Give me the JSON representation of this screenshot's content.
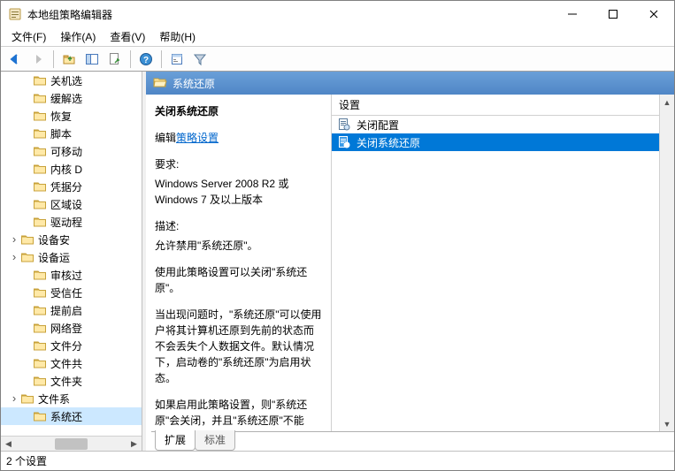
{
  "window": {
    "title": "本地组策略编辑器"
  },
  "menu": {
    "file": "文件(F)",
    "action": "操作(A)",
    "view": "查看(V)",
    "help": "帮助(H)"
  },
  "tree": {
    "items": [
      {
        "label": "关机选",
        "indent": 4,
        "exp": ""
      },
      {
        "label": "缓解选",
        "indent": 4,
        "exp": ""
      },
      {
        "label": "恢复",
        "indent": 4,
        "exp": ""
      },
      {
        "label": "脚本",
        "indent": 4,
        "exp": ""
      },
      {
        "label": "可移动",
        "indent": 4,
        "exp": ""
      },
      {
        "label": "内核 D",
        "indent": 4,
        "exp": ""
      },
      {
        "label": "凭据分",
        "indent": 4,
        "exp": ""
      },
      {
        "label": "区域设",
        "indent": 4,
        "exp": ""
      },
      {
        "label": "驱动程",
        "indent": 4,
        "exp": ""
      },
      {
        "label": "设备安",
        "indent": 3,
        "exp": ">"
      },
      {
        "label": "设备运",
        "indent": 3,
        "exp": ">"
      },
      {
        "label": "审核过",
        "indent": 4,
        "exp": ""
      },
      {
        "label": "受信任",
        "indent": 4,
        "exp": ""
      },
      {
        "label": "提前启",
        "indent": 4,
        "exp": ""
      },
      {
        "label": "网络登",
        "indent": 4,
        "exp": ""
      },
      {
        "label": "文件分",
        "indent": 4,
        "exp": ""
      },
      {
        "label": "文件共",
        "indent": 4,
        "exp": ""
      },
      {
        "label": "文件夹",
        "indent": 4,
        "exp": ""
      },
      {
        "label": "文件系",
        "indent": 3,
        "exp": ">"
      },
      {
        "label": "系统还",
        "indent": 4,
        "exp": "",
        "selected": true
      }
    ]
  },
  "right": {
    "header": "系统还原",
    "desc": {
      "title": "关闭系统还原",
      "edit_prefix": "编辑",
      "edit_link": "策略设置",
      "req_label": "要求:",
      "req_text": "Windows Server 2008 R2 或 Windows 7 及以上版本",
      "desc_label": "描述:",
      "desc_text1": "允许禁用\"系统还原\"。",
      "desc_text2": "使用此策略设置可以关闭\"系统还原\"。",
      "desc_text3": "当出现问题时，\"系统还原\"可以使用户将其计算机还原到先前的状态而不会丢失个人数据文件。默认情况下，启动卷的\"系统还原\"为启用状态。",
      "desc_text4": "如果启用此策略设置，则\"系统还原\"会关闭，并且\"系统还原\"不能"
    },
    "column": "设置",
    "rows": [
      {
        "label": "关闭配置",
        "icon": "policy",
        "selected": false
      },
      {
        "label": "关闭系统还原",
        "icon": "policy",
        "selected": true
      }
    ],
    "tabs": {
      "extended": "扩展",
      "standard": "标准"
    }
  },
  "status": "2 个设置"
}
